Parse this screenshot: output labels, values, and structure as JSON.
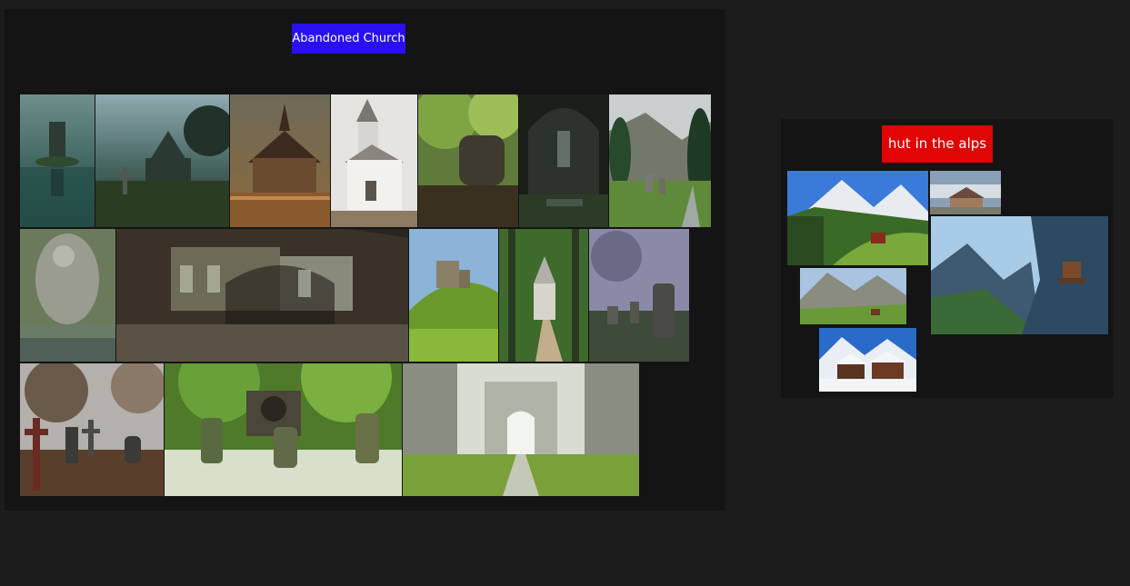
{
  "boards": [
    {
      "id": "church",
      "title": "Abandoned Church",
      "title_color": "#2a0ff0",
      "images": 15
    },
    {
      "id": "alps",
      "title": "hut in the alps",
      "title_color": "#e00404",
      "images": 5
    }
  ],
  "colors": {
    "canvas": "#1c1c1c",
    "board": "#141414"
  }
}
